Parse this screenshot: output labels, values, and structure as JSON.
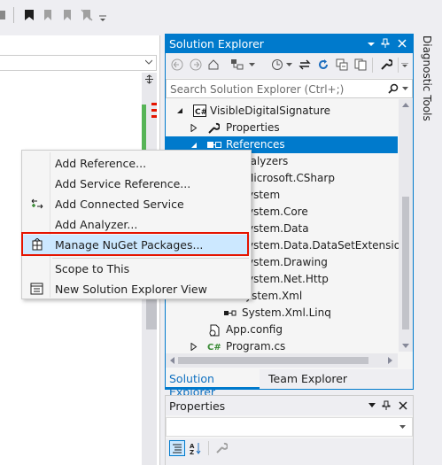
{
  "solution_explorer": {
    "title": "Solution Explorer",
    "search_placeholder": "Search Solution Explorer (Ctrl+;)",
    "tree": [
      {
        "label": "VisibleDigitalSignature",
        "icon": "csharp-project-icon"
      },
      {
        "label": "Properties",
        "icon": "wrench-icon"
      },
      {
        "label": "References",
        "icon": "references-icon"
      },
      {
        "label": "Analyzers",
        "visible": "nalyzers"
      },
      {
        "label": "Microsoft.CSharp",
        "visible": "Microsoft.CSharp"
      },
      {
        "label": "System",
        "visible": "ystem"
      },
      {
        "label": "System.Core",
        "visible": "ystem.Core"
      },
      {
        "label": "System.Data",
        "visible": "ystem.Data"
      },
      {
        "label": "System.Data.DataSetExtensions",
        "visible": "ystem.Data.DataSetExtensions"
      },
      {
        "label": "System.Drawing",
        "visible": "ystem.Drawing"
      },
      {
        "label": "System.Net.Http",
        "visible": "ystem.Net.Http"
      },
      {
        "label": "System.Xml",
        "visible": "ystem.Xml"
      },
      {
        "label": "System.Xml.Linq"
      },
      {
        "label": "App.config"
      },
      {
        "label": "Program.cs"
      }
    ],
    "tabs": [
      "Solution Explorer",
      "Team Explorer"
    ]
  },
  "properties": {
    "title": "Properties"
  },
  "diagnostic_tools": {
    "title": "Diagnostic Tools"
  },
  "context_menu": {
    "items": [
      {
        "label": "Add Reference..."
      },
      {
        "label": "Add Service Reference..."
      },
      {
        "label": "Add Connected Service"
      },
      {
        "label": "Add Analyzer..."
      },
      {
        "label": "Manage NuGet Packages..."
      },
      {
        "label": "Scope to This"
      },
      {
        "label": "New Solution Explorer View"
      }
    ]
  },
  "colors": {
    "accent": "#007acc",
    "highlight_box": "#e51400",
    "selected_bg": "#cce8ff"
  }
}
